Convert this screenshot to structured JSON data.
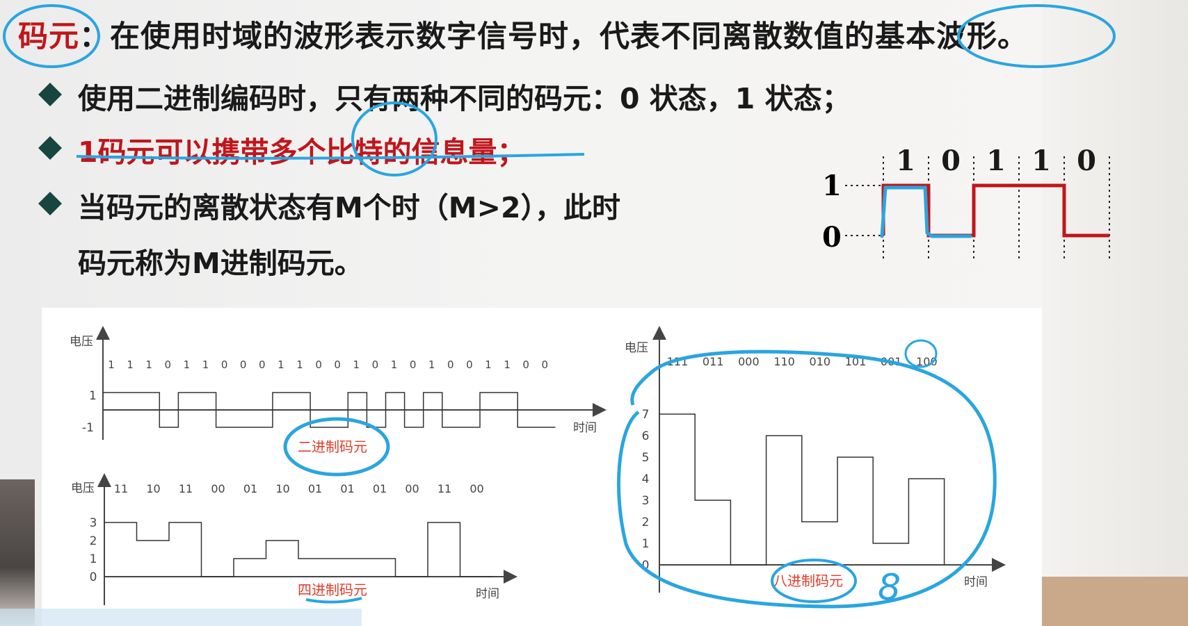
{
  "title": {
    "term": "码元",
    "rest": "：在使用时域的波形表示数字信号时，代表不同离散数值的基本波形。"
  },
  "bullets": [
    "使用二进制编码时，只有两种不同的码元：0 状态，1 状态；",
    "1码元可以携带多个比特的信息量；",
    "当码元的离散状态有M个时（M>2），此时",
    "码元称为M进制码元。"
  ],
  "small_wave": {
    "bits": [
      "1",
      "0",
      "1",
      "1",
      "0"
    ],
    "level_high": "1",
    "level_low": "0"
  },
  "binary_chart": {
    "ylabel": "电压",
    "xlabel": "时间",
    "yticks": [
      "1",
      "-1"
    ],
    "bits": [
      "1",
      "1",
      "1",
      "0",
      "1",
      "1",
      "0",
      "0",
      "0",
      "1",
      "1",
      "0",
      "0",
      "1",
      "0",
      "1",
      "0",
      "1",
      "0",
      "0",
      "1",
      "1",
      "0",
      "0"
    ],
    "caption": "二进制码元"
  },
  "quaternary_chart": {
    "ylabel": "电压",
    "xlabel": "时间",
    "yticks": [
      "3",
      "2",
      "1",
      "0"
    ],
    "symbols": [
      "11",
      "10",
      "11",
      "00",
      "01",
      "10",
      "01",
      "01",
      "01",
      "00",
      "11",
      "00"
    ],
    "values": [
      3,
      2,
      3,
      0,
      1,
      2,
      1,
      1,
      1,
      0,
      3,
      0
    ],
    "caption": "四进制码元"
  },
  "octal_chart": {
    "ylabel": "电压",
    "xlabel": "时间",
    "yticks": [
      "7",
      "6",
      "5",
      "4",
      "3",
      "2",
      "1",
      "0"
    ],
    "symbols": [
      "111",
      "011",
      "000",
      "110",
      "010",
      "101",
      "001",
      "100"
    ],
    "values": [
      7,
      3,
      0,
      6,
      2,
      5,
      1,
      4
    ],
    "caption": "八进制码元",
    "annotation": "8"
  },
  "colors": {
    "accent_red": "#c0161b",
    "ink_blue": "#2aa5e0",
    "bullet_green": "#17453f"
  }
}
